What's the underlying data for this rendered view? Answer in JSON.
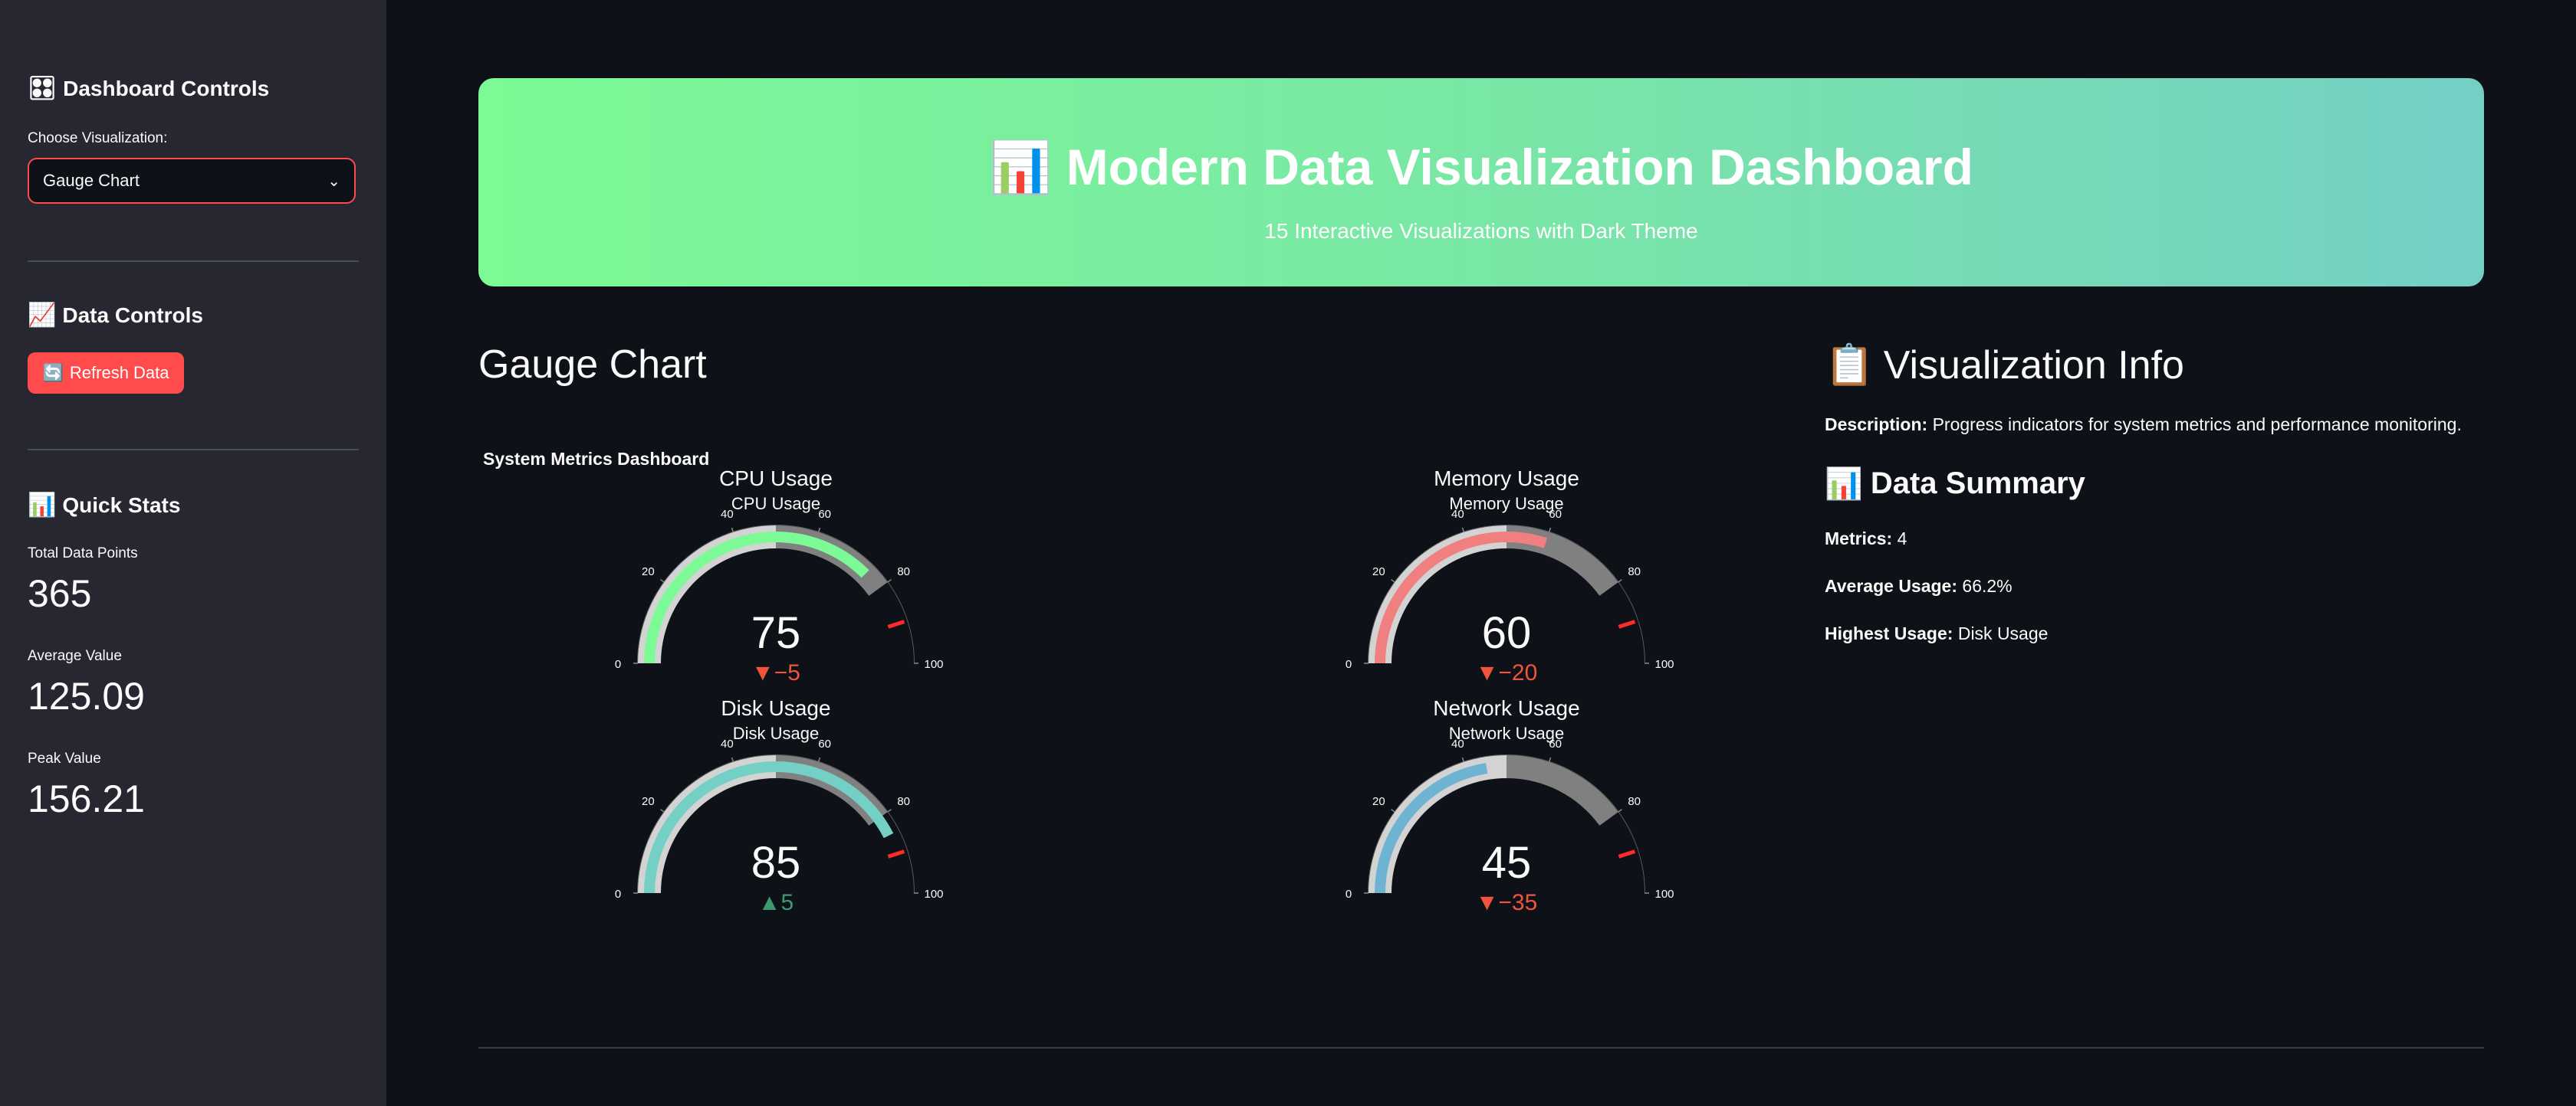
{
  "sidebar": {
    "controls_heading": "Dashboard Controls",
    "controls_icon": "control-knobs-icon",
    "choose_label": "Choose Visualization:",
    "selected_visualization": "Gauge Chart",
    "data_controls_heading": "Data Controls",
    "data_controls_icon": "chart-increasing-icon",
    "refresh_label": "Refresh Data",
    "refresh_icon": "refresh-icon",
    "quick_stats_heading": "Quick Stats",
    "quick_stats_icon": "bar-chart-icon",
    "stats": [
      {
        "label": "Total Data Points",
        "value": "365"
      },
      {
        "label": "Average Value",
        "value": "125.09"
      },
      {
        "label": "Peak Value",
        "value": "156.21"
      }
    ]
  },
  "hero": {
    "title": "Modern Data Visualization Dashboard",
    "subtitle": "15 Interactive Visualizations with Dark Theme",
    "accent_start": "#7bfa95",
    "accent_end": "#74cfc5"
  },
  "main": {
    "section_title": "Gauge Chart",
    "figure_title": "System Metrics Dashboard"
  },
  "chart_data": {
    "type": "gauge",
    "title": "System Metrics Dashboard",
    "range": [
      0,
      100
    ],
    "ticks": [
      "0",
      "20",
      "40",
      "60",
      "80",
      "100"
    ],
    "steps": [
      {
        "from": 0,
        "to": 50,
        "color": "#d3d3d3"
      },
      {
        "from": 50,
        "to": 80,
        "color": "#808080"
      }
    ],
    "threshold": 90,
    "threshold_color": "#ff2b2b",
    "gauges": [
      {
        "title": "CPU Usage",
        "value": 75,
        "delta": "▼−5",
        "delta_color": "#ef553b",
        "bar_color": "#7bfa95"
      },
      {
        "title": "Memory Usage",
        "value": 60,
        "delta": "▼−20",
        "delta_color": "#ef553b",
        "bar_color": "#f08080"
      },
      {
        "title": "Disk Usage",
        "value": 85,
        "delta": "▲5",
        "delta_color": "#3d9970",
        "bar_color": "#74cfc5"
      },
      {
        "title": "Network Usage",
        "value": 45,
        "delta": "▼−35",
        "delta_color": "#ef553b",
        "bar_color": "#6fb3d2"
      }
    ]
  },
  "info": {
    "heading": "Visualization Info",
    "heading_icon": "clipboard-icon",
    "description_label": "Description:",
    "description": "Progress indicators for system metrics and performance monitoring.",
    "summary_heading": "Data Summary",
    "summary_icon": "bar-chart-icon",
    "metrics_label": "Metrics:",
    "metrics_value": "4",
    "avg_label": "Average Usage:",
    "avg_value": "66.2%",
    "highest_label": "Highest Usage:",
    "highest_value": "Disk Usage"
  }
}
